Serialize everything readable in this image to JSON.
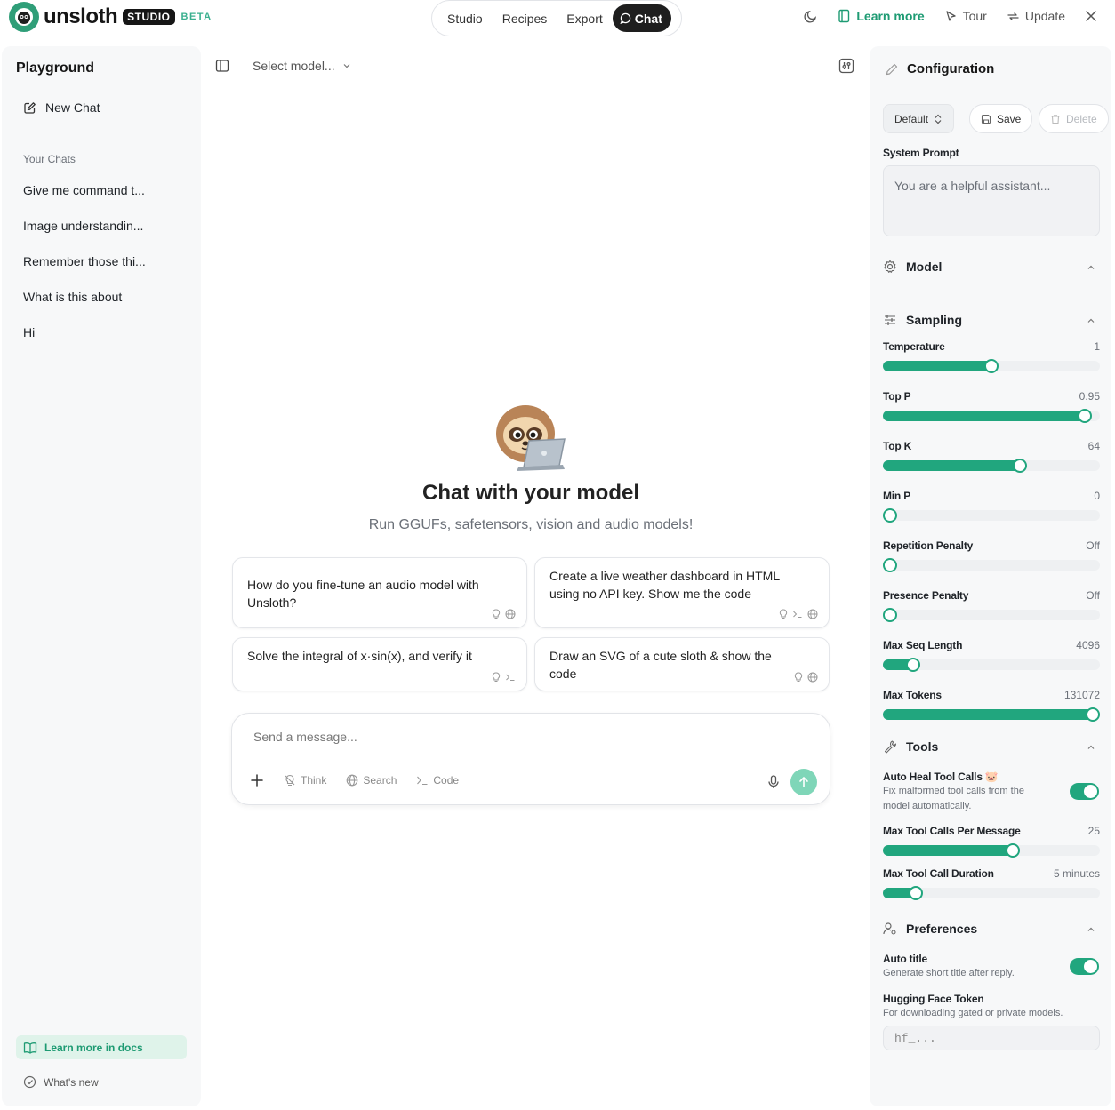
{
  "brand": {
    "name": "unsloth",
    "studio": "STUDIO",
    "beta": "BETA"
  },
  "nav": {
    "tabs": [
      "Studio",
      "Recipes",
      "Export"
    ],
    "active": "Chat"
  },
  "top_actions": {
    "learn_more": "Learn more",
    "tour": "Tour",
    "update": "Update"
  },
  "sidebar": {
    "title": "Playground",
    "new_chat": "New Chat",
    "section": "Your Chats",
    "chats": [
      "Give me command t...",
      "Image understandin...",
      "Remember those thi...",
      "What is this about",
      "Hi"
    ],
    "docs_link": "Learn more in docs",
    "whats_new": "What's new"
  },
  "main": {
    "model_select": "Select model...",
    "hero_title": "Chat with your model",
    "hero_subtitle": "Run GGUFs, safetensors, vision and audio models!",
    "suggestions": [
      "How do you fine-tune an audio model with Unsloth?",
      "Create a live weather dashboard in HTML using no API key. Show me the code",
      "Solve the integral of x·sin(x), and verify it",
      "Draw an SVG of a cute sloth & show the code"
    ],
    "composer": {
      "placeholder": "Send a message...",
      "think": "Think",
      "search": "Search",
      "code": "Code"
    }
  },
  "config": {
    "title": "Configuration",
    "preset": "Default",
    "save": "Save",
    "delete": "Delete",
    "system_prompt_label": "System Prompt",
    "system_prompt_placeholder": "You are a helpful assistant...",
    "sections": {
      "model": "Model",
      "sampling": "Sampling",
      "tools": "Tools",
      "preferences": "Preferences"
    },
    "sampling": [
      {
        "label": "Temperature",
        "value": "1",
        "fraction": 0.5
      },
      {
        "label": "Top P",
        "value": "0.95",
        "fraction": 0.93
      },
      {
        "label": "Top K",
        "value": "64",
        "fraction": 0.63
      },
      {
        "label": "Min P",
        "value": "0",
        "fraction": 0.0
      },
      {
        "label": "Repetition Penalty",
        "value": "Off",
        "fraction": 0.0
      },
      {
        "label": "Presence Penalty",
        "value": "Off",
        "fraction": 0.0
      },
      {
        "label": "Max Seq Length",
        "value": "4096",
        "fraction": 0.14
      },
      {
        "label": "Max Tokens",
        "value": "131072",
        "fraction": 1.0
      }
    ],
    "tools": {
      "auto_heal_label": "Auto Heal Tool Calls 🐷",
      "auto_heal_desc_1": "Fix malformed tool calls from the",
      "auto_heal_desc_2": "model automatically.",
      "auto_heal_on": true,
      "max_calls_label": "Max Tool Calls Per Message",
      "max_calls_value": "25",
      "max_calls_fraction": 0.6,
      "max_duration_label": "Max Tool Call Duration",
      "max_duration_value": "5 minutes",
      "max_duration_fraction": 0.15
    },
    "preferences": {
      "auto_title_label": "Auto title",
      "auto_title_desc": "Generate short title after reply.",
      "auto_title_on": true,
      "hf_label": "Hugging Face Token",
      "hf_desc": "For downloading gated or private models.",
      "hf_placeholder": "hf_..."
    }
  },
  "colors": {
    "accent": "#21a67e",
    "accent_light": "#dff3ea",
    "panel_bg": "#f7f8f9"
  }
}
